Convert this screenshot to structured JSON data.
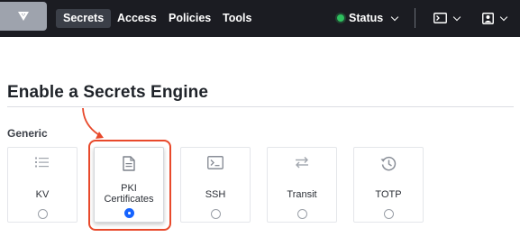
{
  "nav": {
    "items": [
      {
        "label": "Secrets",
        "active": true
      },
      {
        "label": "Access",
        "active": false
      },
      {
        "label": "Policies",
        "active": false
      },
      {
        "label": "Tools",
        "active": false
      }
    ],
    "status_label": "Status"
  },
  "page": {
    "title": "Enable a Secrets Engine",
    "group_label": "Generic"
  },
  "engines": [
    {
      "label": "KV",
      "icon": "list-icon",
      "selected": false
    },
    {
      "label": "PKI\nCertificates",
      "icon": "document-icon",
      "selected": true
    },
    {
      "label": "SSH",
      "icon": "terminal-icon",
      "selected": false
    },
    {
      "label": "Transit",
      "icon": "swap-arrows-icon",
      "selected": false
    },
    {
      "label": "TOTP",
      "icon": "history-icon",
      "selected": false
    }
  ],
  "colors": {
    "topbar": "#1b1c22",
    "status_ok": "#2ec05e",
    "radio_selected": "#1563ff",
    "annotation": "#e8492b"
  }
}
